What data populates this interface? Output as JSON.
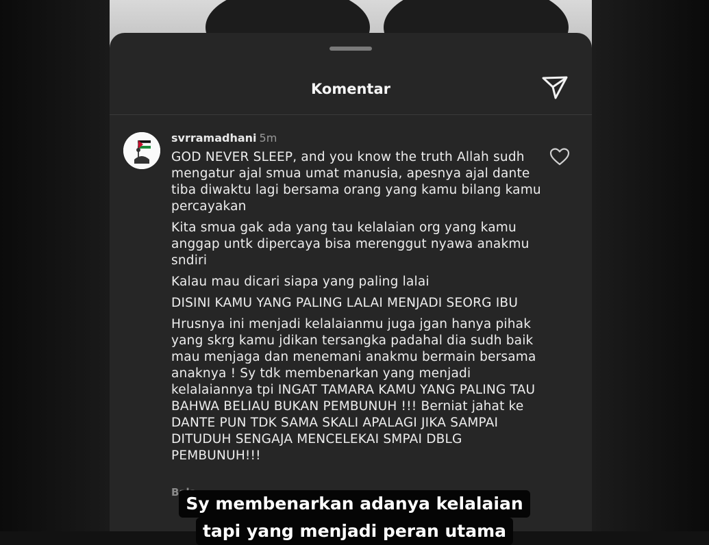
{
  "sheet": {
    "title": "Komentar"
  },
  "comment": {
    "username": "svrramadhani",
    "time": "5m",
    "paragraphs": [
      "GOD NEVER SLEEP, and you know the truth Allah sudh mengatur ajal smua umat manusia, apesnya ajal dante tiba diwaktu lagi bersama orang yang kamu bilang kamu percayakan",
      "Kita smua gak ada yang tau kelalaian org yang kamu anggap untk dipercaya bisa merenggut nyawa anakmu sndiri",
      "Kalau mau dicari siapa yang paling lalai",
      "DISINI KAMU YANG PALING LALAI MENJADI SEORG IBU",
      "Hrusnya ini menjadi kelalaianmu juga jgan hanya pihak yang skrg kamu jdikan tersangka padahal dia sudh baik mau menjaga dan menemani anakmu bermain bersama anaknya ! Sy tdk membenarkan yang menjadi kelalaiannya tpi INGAT TAMARA KAMU YANG PALING TAU BAHWA BELIAU BUKAN PEMBUNUH !!! Berniat jahat ke DANTE PUN TDK SAMA SKALI APALAGI JIKA SAMPAI DITUDUH SENGAJA MENCELEKAI SMPAI DBLG PEMBUNUH!!!"
    ],
    "reply_label": "Bala"
  },
  "caption": {
    "line1": "Sy membenarkan adanya kelalaian",
    "line2": "tapi yang menjadi peran utama"
  },
  "icons": {
    "send": "paper-plane-icon",
    "like": "heart-icon",
    "avatar": "palestine-flag-avatar"
  }
}
